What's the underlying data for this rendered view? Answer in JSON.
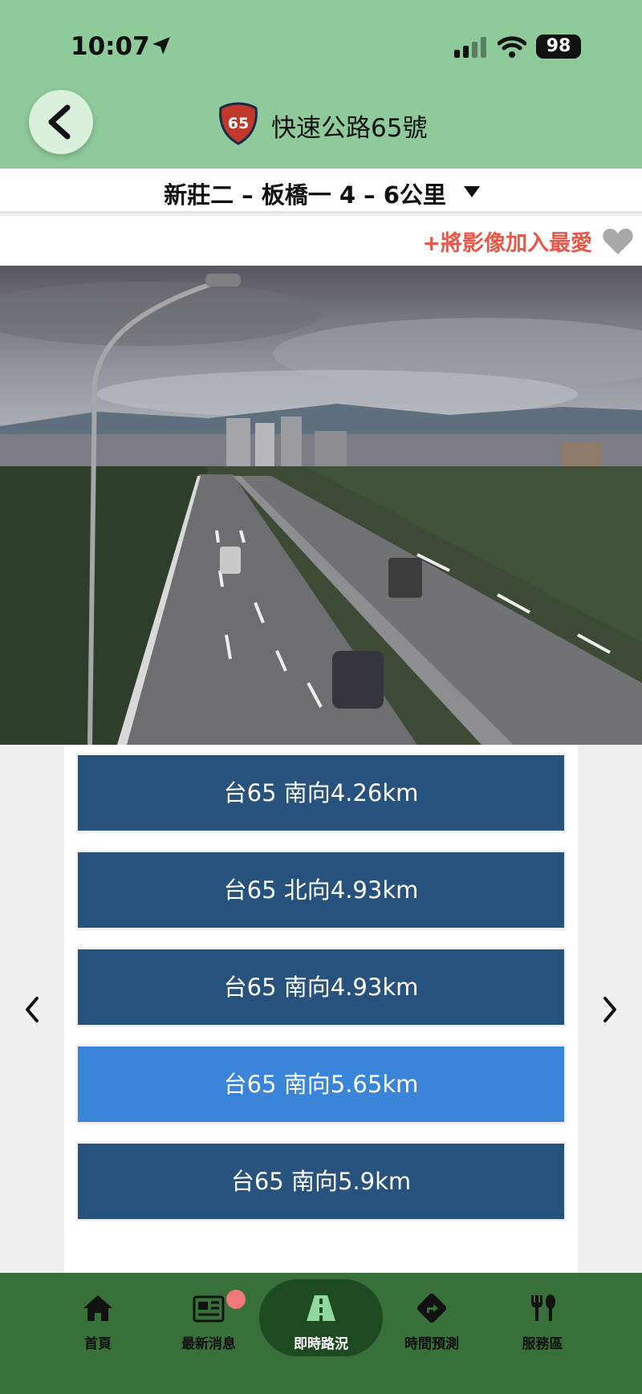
{
  "status_bar": {
    "time": "10:07",
    "battery": "98"
  },
  "header": {
    "route_number": "65",
    "title": "快速公路65號"
  },
  "segment": {
    "label": "新莊二 – 板橋一 4 – 6公里"
  },
  "favorite": {
    "label": "+將影像加入最愛"
  },
  "cameras": [
    {
      "label": "台65 南向4.26km",
      "active": false
    },
    {
      "label": "台65 北向4.93km",
      "active": false
    },
    {
      "label": "台65 南向4.93km",
      "active": false
    },
    {
      "label": "台65 南向5.65km",
      "active": true
    },
    {
      "label": "台65 南向5.9km",
      "active": false
    }
  ],
  "tabs": [
    {
      "label": "首頁",
      "icon": "home-icon"
    },
    {
      "label": "最新消息",
      "icon": "news-icon"
    },
    {
      "label": "即時路況",
      "icon": "road-icon"
    },
    {
      "label": "時間預測",
      "icon": "direction-sign-icon"
    },
    {
      "label": "服務區",
      "icon": "fork-knife-icon"
    }
  ],
  "colors": {
    "header_bg": "#8fca9a",
    "tabbar_bg": "#377039",
    "camera_item_bg": "#27527e",
    "camera_item_active_bg": "#3a85d9",
    "favorite_text": "#e8584a"
  }
}
